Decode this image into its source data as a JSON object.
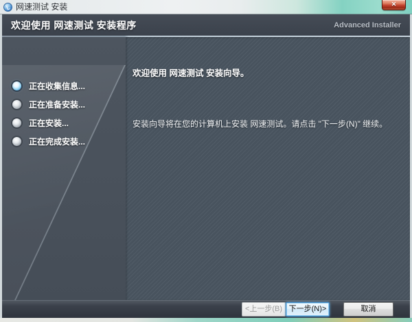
{
  "window": {
    "title": "网速测试 安装",
    "icons": {
      "close": "✕",
      "app": "speedometer"
    }
  },
  "header": {
    "title": "欢迎使用 网速测试 安装程序",
    "brand": "Advanced Installer"
  },
  "sidebar": {
    "steps": [
      {
        "label": "正在收集信息...",
        "active": true
      },
      {
        "label": "正在准备安装...",
        "active": false
      },
      {
        "label": "正在安装...",
        "active": false
      },
      {
        "label": "正在完成安装...",
        "active": false
      }
    ]
  },
  "main": {
    "heading": "欢迎使用 网速测试 安装向导。",
    "body_text": "安装向导将在您的计算机上安装 网速测试。请点击 \"下一步(N)\" 继续。"
  },
  "footer": {
    "back_label": "<上一步(B)",
    "next_label": "下一步(N)>",
    "cancel_label": "取消"
  },
  "colors": {
    "accent": "#56aee4",
    "close_red": "#c4442f",
    "titlebar_teal": "#7fd0c1",
    "header_bg": "#3b424c",
    "sidebar_bg": "#49515b",
    "main_bg": "#48535e",
    "stripe": "#515c67",
    "footer_bg": "#2f343d"
  }
}
